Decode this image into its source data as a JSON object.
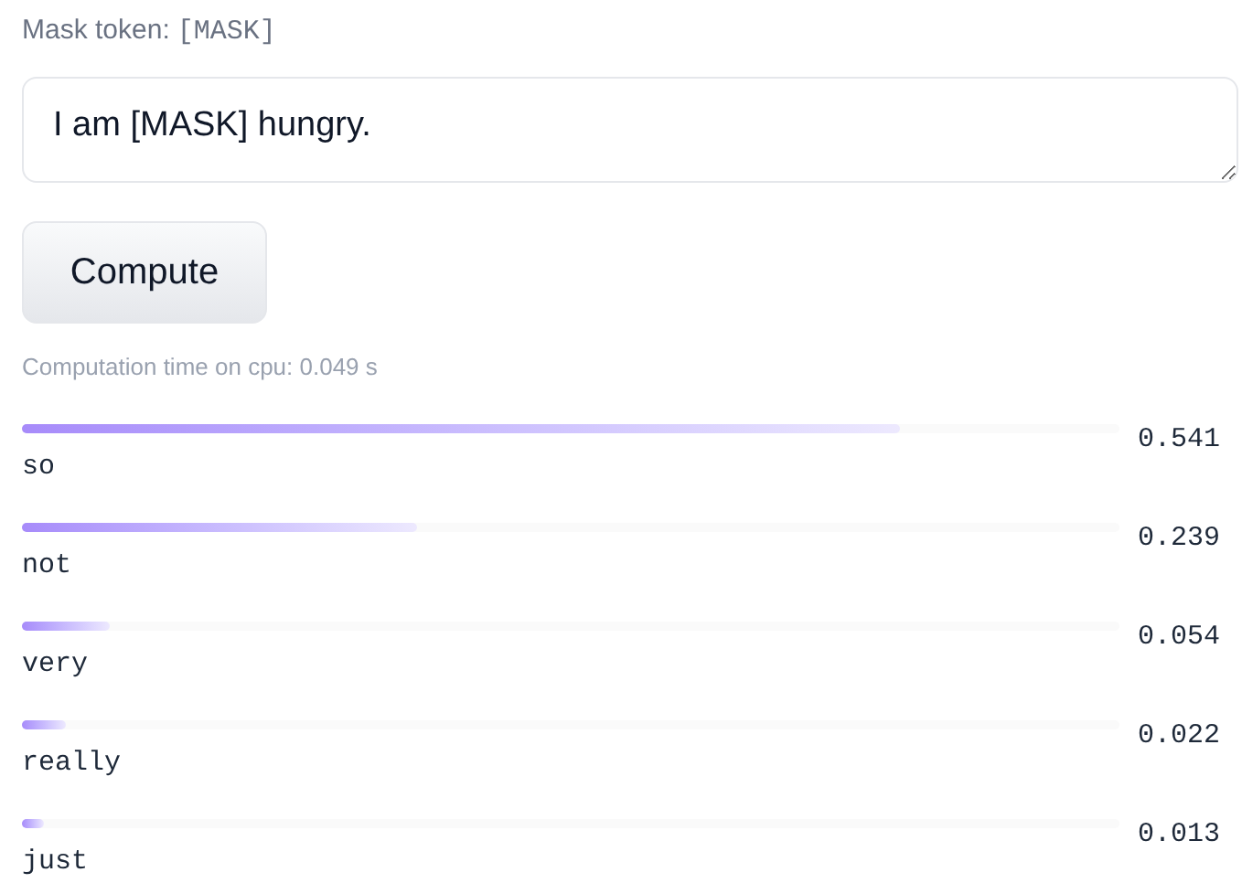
{
  "mask_token": {
    "label": "Mask token:",
    "token": "[MASK]"
  },
  "input": {
    "value": "I am [MASK] hungry."
  },
  "compute_button": {
    "label": "Compute"
  },
  "computation_time": "Computation time on cpu: 0.049 s",
  "predictions": [
    {
      "token": "so",
      "score": "0.541",
      "level": 0.8
    },
    {
      "token": "not",
      "score": "0.239",
      "level": 0.36
    },
    {
      "token": "very",
      "score": "0.054",
      "level": 0.08
    },
    {
      "token": "really",
      "score": "0.022",
      "level": 0.04
    },
    {
      "token": "just",
      "score": "0.013",
      "level": 0.02
    }
  ]
}
